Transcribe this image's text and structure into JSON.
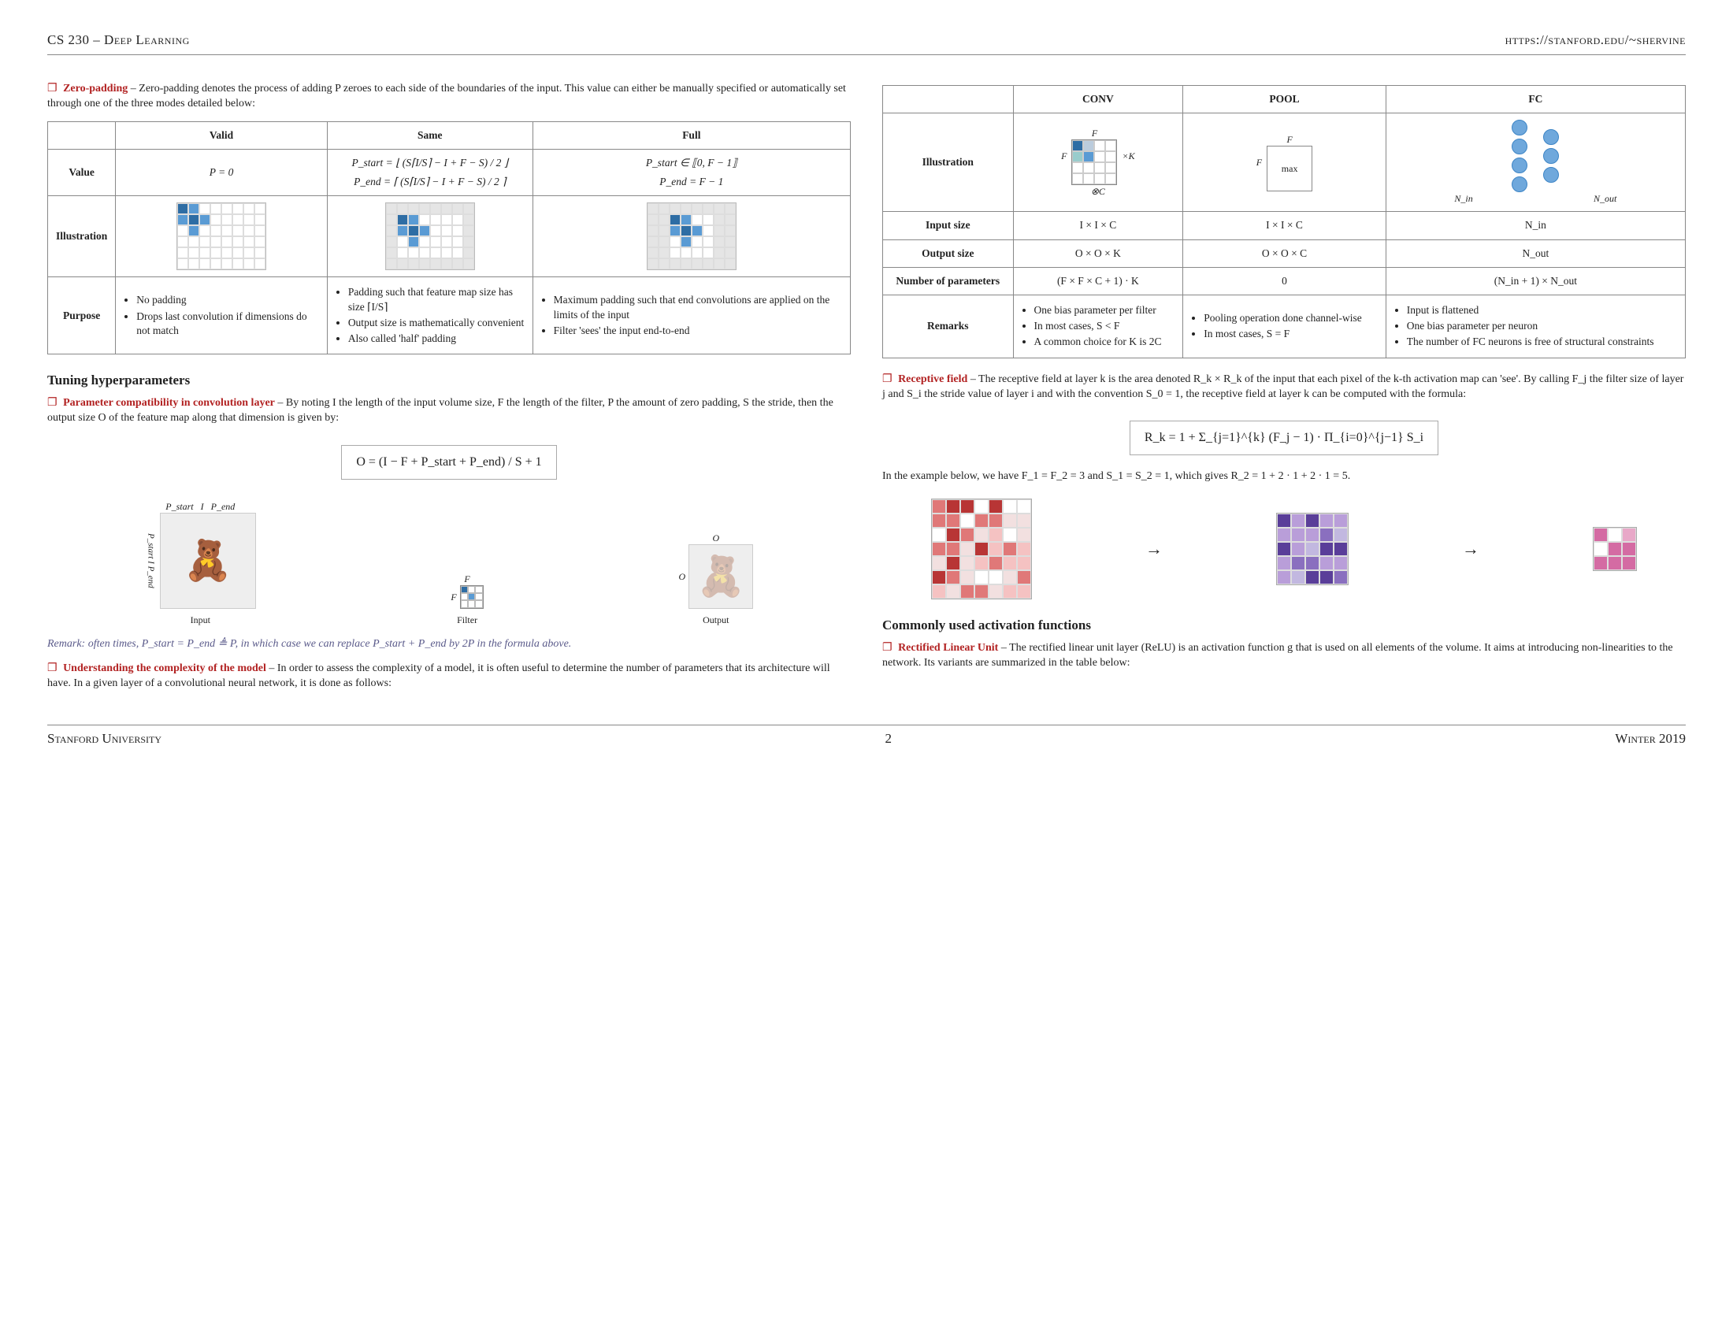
{
  "header": {
    "left": "CS 230 – Deep Learning",
    "right": "https://stanford.edu/~shervine"
  },
  "footer": {
    "left": "Stanford University",
    "page": "2",
    "right": "Winter 2019"
  },
  "zp": {
    "title": "Zero-padding",
    "desc": "– Zero-padding denotes the process of adding P zeroes to each side of the boundaries of the input. This value can either be manually specified or automatically set through one of the three modes detailed below:"
  },
  "zp_table": {
    "rows": [
      "Value",
      "Illustration",
      "Purpose"
    ],
    "cols": [
      "Valid",
      "Same",
      "Full"
    ],
    "value": {
      "valid": "P = 0",
      "same": {
        "start": "P_start = ⌊ (S⌈I/S⌉ − I + F − S) / 2 ⌋",
        "end": "P_end = ⌈ (S⌈I/S⌉ − I + F − S) / 2 ⌉"
      },
      "full": {
        "start": "P_start ∈ ⟦0, F − 1⟧",
        "end": "P_end = F − 1"
      }
    },
    "purpose": {
      "valid": [
        "No padding",
        "Drops last convolution if dimensions do not match"
      ],
      "same": [
        "Padding such that feature map size has size ⌈I/S⌉",
        "Output size is mathematically convenient",
        "Also called 'half' padding"
      ],
      "full": [
        "Maximum padding such that end convolutions are applied on the limits of the input",
        "Filter 'sees' the input end-to-end"
      ]
    }
  },
  "tuning": {
    "heading": "Tuning hyperparameters",
    "param_compat": {
      "title": "Parameter compatibility in convolution layer",
      "desc": "– By noting I the length of the input volume size, F the length of the filter, P the amount of zero padding, S the stride, then the output size O of the feature map along that dimension is given by:",
      "formula": "O = (I − F + P_start + P_end) / S + 1",
      "labels": {
        "input": "Input",
        "filter": "Filter",
        "output": "Output",
        "I": "I",
        "F": "F",
        "O": "O",
        "pstart": "P_start",
        "pend": "P_end"
      },
      "remark": "Remark: often times, P_start = P_end ≜ P, in which case we can replace P_start + P_end by 2P in the formula above."
    },
    "complexity": {
      "title": "Understanding the complexity of the model",
      "desc": "– In order to assess the complexity of a model, it is often useful to determine the number of parameters that its architecture will have. In a given layer of a convolutional neural network, it is done as follows:"
    }
  },
  "layer_table": {
    "cols": [
      "CONV",
      "POOL",
      "FC"
    ],
    "rows": [
      "Illustration",
      "Input size",
      "Output size",
      "Number of parameters",
      "Remarks"
    ],
    "illus_labels": {
      "F": "F",
      "K": "×K",
      "C": "⊗C",
      "max": "max",
      "Nin": "N_in",
      "Nout": "N_out"
    },
    "input_size": {
      "conv": "I × I × C",
      "pool": "I × I × C",
      "fc": "N_in"
    },
    "output_size": {
      "conv": "O × O × K",
      "pool": "O × O × C",
      "fc": "N_out"
    },
    "num_params": {
      "conv": "(F × F × C + 1) · K",
      "pool": "0",
      "fc": "(N_in + 1) × N_out"
    },
    "remarks": {
      "conv": [
        "One bias parameter per filter",
        "In most cases, S < F",
        "A common choice for K is 2C"
      ],
      "pool": [
        "Pooling operation done channel-wise",
        "In most cases, S = F"
      ],
      "fc": [
        "Input is flattened",
        "One bias parameter per neuron",
        "The number of FC neurons is free of structural constraints"
      ]
    }
  },
  "receptive": {
    "title": "Receptive field",
    "desc": "– The receptive field at layer k is the area denoted R_k × R_k of the input that each pixel of the k-th activation map can 'see'. By calling F_j the filter size of layer j and S_i the stride value of layer i and with the convention S_0 = 1, the receptive field at layer k can be computed with the formula:",
    "formula": "R_k = 1 + Σ_{j=1}^{k} (F_j − 1) · Π_{i=0}^{j−1} S_i",
    "example": "In the example below, we have F_1 = F_2 = 3 and S_1 = S_2 = 1, which gives R_2 = 1 + 2 · 1 + 2 · 1 = 5."
  },
  "activation": {
    "heading": "Commonly used activation functions",
    "relu": {
      "title": "Rectified Linear Unit",
      "desc": "– The rectified linear unit layer (ReLU) is an activation function g that is used on all elements of the volume. It aims at introducing non-linearities to the network. Its variants are summarized in the table below:"
    }
  }
}
